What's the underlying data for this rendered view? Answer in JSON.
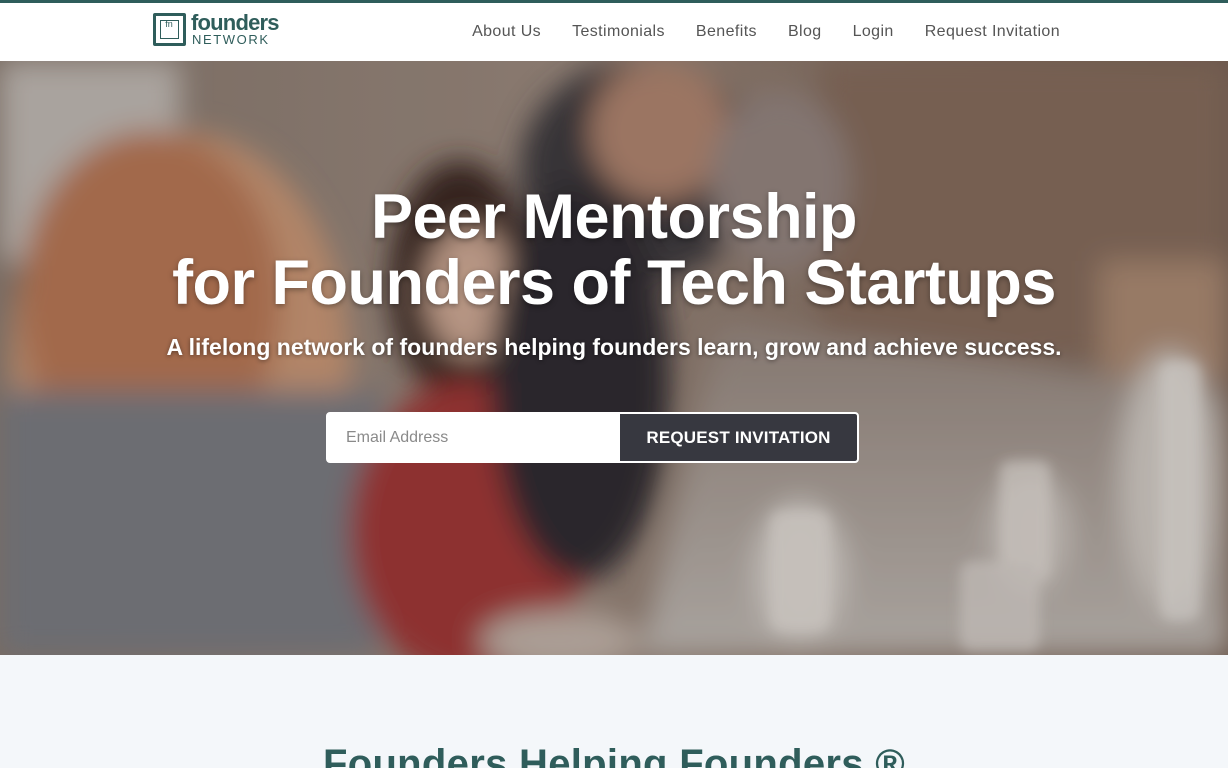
{
  "header": {
    "logo": {
      "mark": "fn",
      "word1": "founders",
      "word2": "NETWORK"
    },
    "nav": [
      {
        "label": "About Us"
      },
      {
        "label": "Testimonials"
      },
      {
        "label": "Benefits"
      },
      {
        "label": "Blog"
      },
      {
        "label": "Login"
      },
      {
        "label": "Request Invitation"
      }
    ]
  },
  "hero": {
    "title_line1": "Peer Mentorship",
    "title_line2": "for Founders of Tech Startups",
    "subtitle": "A lifelong network of founders helping founders learn, grow and achieve success.",
    "email_placeholder": "Email Address",
    "cta_label": "REQUEST INVITATION"
  },
  "section": {
    "title": "Founders Helping Founders ®"
  },
  "colors": {
    "brand": "#2f5d5b",
    "button": "#373840",
    "section_bg": "#f4f7fa"
  }
}
